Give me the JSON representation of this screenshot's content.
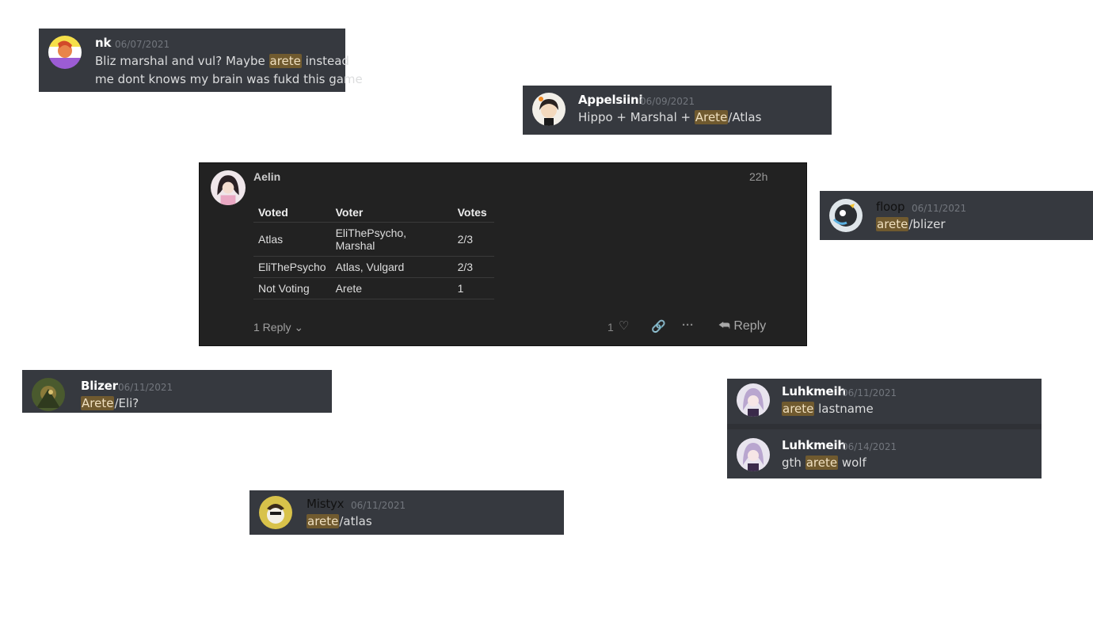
{
  "posts": {
    "nk": {
      "user": "nk",
      "time": "06/07/2021",
      "line1_a": "Bliz marshal and vul? Maybe ",
      "line1_hl": "arete",
      "line1_b": " instead",
      "line2": "me dont knows my brain was fukd this game"
    },
    "appelsiini": {
      "user": "Appelsiini",
      "time": "06/09/2021",
      "a": "Hippo + Marshal + ",
      "hl": "Arete",
      "b": "/Atlas"
    },
    "floop": {
      "user": "floop",
      "time": "06/11/2021",
      "hl": "arete",
      "b": "/blizer"
    },
    "blizer": {
      "user": "Blizer",
      "time": "06/11/2021",
      "hl": "Arete",
      "b": "/Eli?"
    },
    "luhk1": {
      "user": "Luhkmeih",
      "time": "06/11/2021",
      "hl": "arete",
      "b": " lastname"
    },
    "luhk2": {
      "user": "Luhkmeih",
      "time": "06/14/2021",
      "a": "gth ",
      "hl": "arete",
      "b": " wolf"
    },
    "mistyx": {
      "user": "Mistyx",
      "time": "06/11/2021",
      "hl": "arete",
      "b": "/atlas"
    }
  },
  "aelin": {
    "user": "Aelin",
    "time": "22h",
    "table": {
      "headers": [
        "Voted",
        "Voter",
        "Votes"
      ],
      "rows": [
        [
          "Atlas",
          "EliThePsycho, Marshal",
          "2/3"
        ],
        [
          "EliThePsycho",
          "Atlas, Vulgard",
          "2/3"
        ],
        [
          "Not Voting",
          "Arete",
          "1"
        ]
      ]
    },
    "replies_label": "1 Reply",
    "like_count": "1",
    "reply_label": "Reply"
  },
  "colors": {
    "card_bg": "#36393f",
    "highlight": "#705a2f",
    "forum_bg": "#222222"
  }
}
